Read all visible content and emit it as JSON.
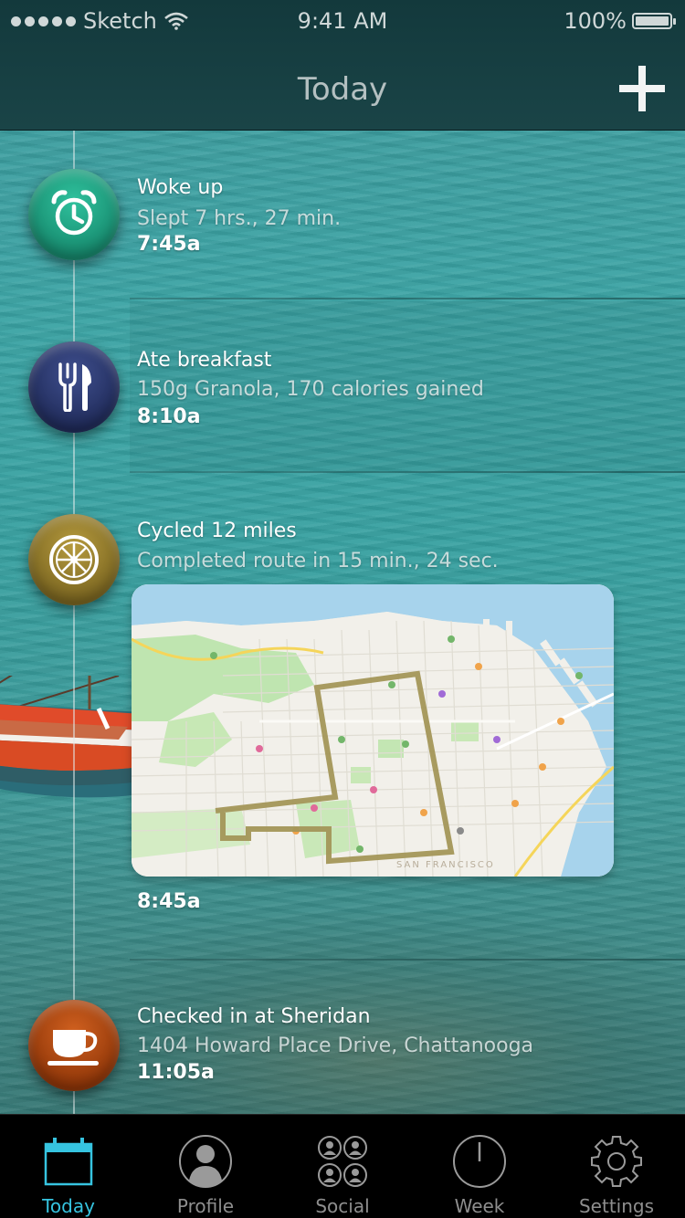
{
  "status_bar": {
    "carrier": "Sketch",
    "time": "9:41 AM",
    "battery": "100%"
  },
  "nav": {
    "title": "Today",
    "add_icon": "plus-icon"
  },
  "timeline": [
    {
      "icon": "alarm-clock-icon",
      "color": "#1fa585",
      "title": "Woke up",
      "subtitle": "Slept 7 hrs., 27 min.",
      "time": "7:45a"
    },
    {
      "icon": "fork-knife-icon",
      "color": "#2b3a72",
      "title": "Ate breakfast",
      "subtitle": "150g Granola, 170 calories gained",
      "time": "8:10a"
    },
    {
      "icon": "bicycle-wheel-icon",
      "color": "#9a8130",
      "title": "Cycled 12 miles",
      "subtitle": "Completed route in 15 min., 24 sec.",
      "time": "8:45a",
      "map_label": "SAN FRANCISCO"
    },
    {
      "icon": "coffee-cup-icon",
      "color": "#b24a12",
      "title": "Checked in at Sheridan",
      "subtitle": "1404 Howard Place Drive, Chattanooga",
      "time": "11:05a"
    }
  ],
  "tabs": [
    {
      "label": "Today",
      "icon": "calendar-icon",
      "active": true
    },
    {
      "label": "Profile",
      "icon": "person-icon",
      "active": false
    },
    {
      "label": "Social",
      "icon": "group-icon",
      "active": false
    },
    {
      "label": "Week",
      "icon": "clock-icon",
      "active": false
    },
    {
      "label": "Settings",
      "icon": "gear-icon",
      "active": false
    }
  ],
  "colors": {
    "accent": "#36c4e0",
    "water": "#3aa3a4",
    "route": "#a39658"
  }
}
